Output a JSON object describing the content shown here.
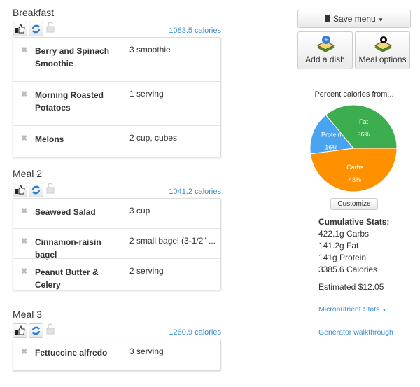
{
  "meals": [
    {
      "title": "Breakfast",
      "calories": "1083.5 calories",
      "items": [
        {
          "name": "Berry and Spinach Smoothie",
          "amount": "3 smoothie"
        },
        {
          "name": "Morning Roasted Potatoes",
          "amount": "1 serving"
        },
        {
          "name": "Melons",
          "amount": "2 cup, cubes"
        }
      ]
    },
    {
      "title": "Meal 2",
      "calories": "1041.2 calories",
      "items": [
        {
          "name": "Seaweed Salad",
          "amount": "3 cup"
        },
        {
          "name": "Cinnamon-raisin bagel",
          "amount": "2 small bagel (3-1/2\" ..."
        },
        {
          "name": "Peanut Butter & Celery",
          "amount": "2 serving"
        }
      ]
    },
    {
      "title": "Meal 3",
      "calories": "1260.9 calories",
      "items": [
        {
          "name": "Fettuccine alfredo",
          "amount": "3 serving"
        }
      ]
    }
  ],
  "sidebar": {
    "save_menu": "Save menu",
    "add_dish": "Add a dish",
    "meal_options": "Meal options",
    "customize": "Customize",
    "stats_title": "Cumulative Stats:",
    "stats": [
      "422.1g Carbs",
      "141.2g Fat",
      "141g Protein",
      "3385.6 Calories"
    ],
    "estimated": "Estimated $12.05",
    "micronutrient": "Micronutrient Stats",
    "walkthrough": "Generator walkthrough"
  },
  "chart_data": {
    "type": "pie",
    "title": "Percent calories from...",
    "slices": [
      {
        "label": "Carbs",
        "value": 48,
        "color": "#ff9100"
      },
      {
        "label": "Protein",
        "value": 16,
        "color": "#4aa3f0"
      },
      {
        "label": "Fat",
        "value": 36,
        "color": "#3cae4f"
      }
    ]
  }
}
